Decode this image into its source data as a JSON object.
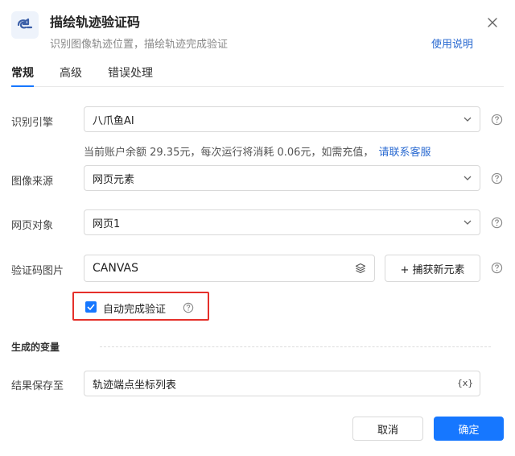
{
  "header": {
    "title": "描绘轨迹验证码",
    "subtitle": "识别图像轨迹位置，描绘轨迹完成验证",
    "help_link": "使用说明"
  },
  "tabs": [
    {
      "label": "常规",
      "active": true
    },
    {
      "label": "高级",
      "active": false
    },
    {
      "label": "错误处理",
      "active": false
    }
  ],
  "form": {
    "engine": {
      "label": "识别引擎",
      "value": "八爪鱼AI"
    },
    "balance_note": {
      "text": "当前账户余额 29.35元，每次运行将消耗 0.06元，如需充值，",
      "link": "请联系客服"
    },
    "image_source": {
      "label": "图像来源",
      "value": "网页元素"
    },
    "web_object": {
      "label": "网页对象",
      "value": "网页1"
    },
    "captcha_image": {
      "label": "验证码图片",
      "value": "CANVAS",
      "capture_button": "+ 捕获新元素"
    },
    "auto_complete": {
      "label": "自动完成验证",
      "checked": true
    }
  },
  "variables": {
    "section_title": "生成的变量",
    "save_to": {
      "label": "结果保存至",
      "value": "轨迹端点坐标列表",
      "icon_text": "{x}"
    }
  },
  "footer": {
    "cancel": "取消",
    "ok": "确定"
  },
  "colors": {
    "accent": "#1677ff",
    "link": "#2a6ad1",
    "highlight": "#e5302a"
  }
}
